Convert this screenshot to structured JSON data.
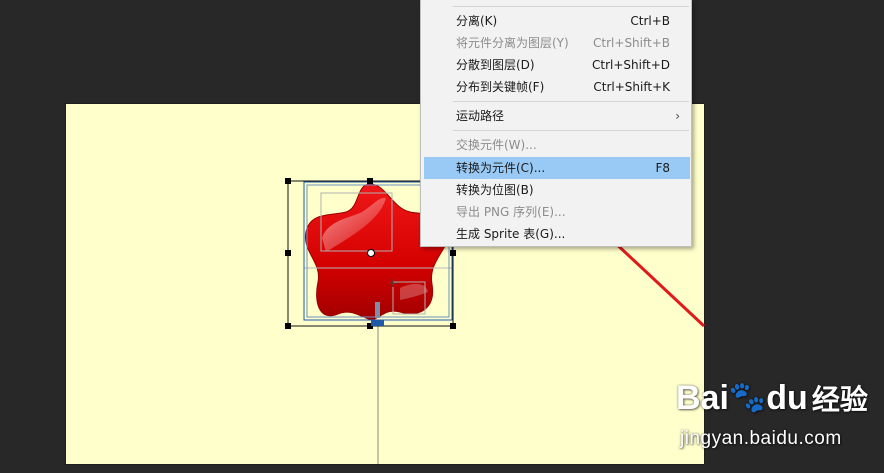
{
  "context_menu": {
    "items": [
      {
        "label": "分离(K)",
        "shortcut": "Ctrl+B",
        "disabled": false
      },
      {
        "label": "将元件分离为图层(Y)",
        "shortcut": "Ctrl+Shift+B",
        "disabled": true
      },
      {
        "label": "分散到图层(D)",
        "shortcut": "Ctrl+Shift+D",
        "disabled": false
      },
      {
        "label": "分布到关键帧(F)",
        "shortcut": "Ctrl+Shift+K",
        "disabled": false
      },
      {
        "label": "运动路径",
        "shortcut": "",
        "disabled": false,
        "submenu_glyph": "›"
      },
      {
        "label": "交换元件(W)...",
        "shortcut": "",
        "disabled": true
      },
      {
        "label": "转换为元件(C)...",
        "shortcut": "F8",
        "disabled": false,
        "highlighted": true
      },
      {
        "label": "转换为位图(B)",
        "shortcut": "",
        "disabled": false
      },
      {
        "label": "导出 PNG 序列(E)...",
        "shortcut": "",
        "disabled": true
      },
      {
        "label": "生成 Sprite 表(G)...",
        "shortcut": "",
        "disabled": false
      }
    ]
  },
  "canvas": {
    "background": "#282828",
    "stage_color": "#ffffcc",
    "shape_color": "#dd0000",
    "annotation_arrow_color": "#e0191b"
  },
  "watermark": {
    "logo_bai": "Bai",
    "logo_paw": "🐾",
    "logo_du": "du",
    "logo_cn": "经验",
    "url": "jingyan.baidu.com"
  }
}
